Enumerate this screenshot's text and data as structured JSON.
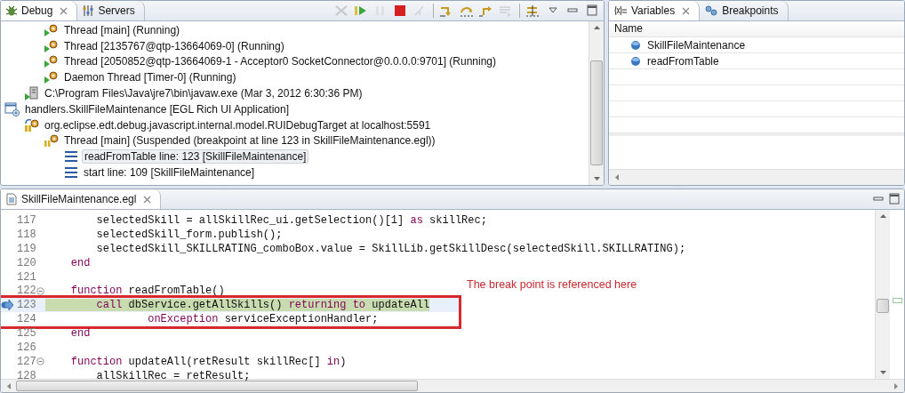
{
  "debug_view": {
    "tabs": [
      {
        "label": "Debug",
        "selected": true
      },
      {
        "label": "Servers",
        "selected": false
      }
    ],
    "toolbar": [
      {
        "kind": "remove",
        "disabled": true
      },
      {
        "kind": "resume",
        "disabled": false
      },
      {
        "kind": "suspend",
        "disabled": true
      },
      {
        "kind": "terminate",
        "disabled": false
      },
      {
        "kind": "disconnect",
        "disabled": true
      },
      {
        "kind": "sep"
      },
      {
        "kind": "step-into",
        "disabled": false
      },
      {
        "kind": "step-over",
        "disabled": false
      },
      {
        "kind": "step-return",
        "disabled": false
      },
      {
        "kind": "drop-frame",
        "disabled": true
      },
      {
        "kind": "sep"
      },
      {
        "kind": "step-filters",
        "disabled": false
      },
      {
        "kind": "menu",
        "disabled": false
      },
      {
        "kind": "minimize",
        "disabled": false
      },
      {
        "kind": "maximize",
        "disabled": false
      }
    ],
    "tree": [
      {
        "children": [
          {
            "children": [
              {
                "label": "Thread [main] (Running)",
                "kind": "thread-running",
                "selected": false
              },
              {
                "label": "Thread [2135767@qtp-13664069-0] (Running)",
                "kind": "thread-running",
                "selected": false
              },
              {
                "label": "Thread [2050852@qtp-13664069-1 - Acceptor0 SocketConnector@0.0.0.0:9701] (Running)",
                "kind": "thread-running",
                "selected": false
              },
              {
                "label": "Daemon Thread [Timer-0] (Running)",
                "kind": "thread-running",
                "selected": false
              }
            ]
          },
          {
            "label": "C:\\Program Files\\Java\\jre7\\bin\\javaw.exe (Mar 3, 2012 6:30:36 PM)",
            "kind": "process",
            "selected": false
          }
        ]
      },
      {
        "label": "handlers.SkillFileMaintenance [EGL Rich UI Application]",
        "kind": "application",
        "selected": false,
        "children": [
          {
            "label": "org.eclipse.edt.debug.javascript.internal.model.RUIDebugTarget at localhost:5591",
            "kind": "target",
            "selected": false,
            "children": [
              {
                "label": "Thread [main] (Suspended (breakpoint at line 123 in SkillFileMaintenance.egl))",
                "kind": "thread-suspended",
                "selected": false,
                "children": [
                  {
                    "label": "readFromTable line: 123 [SkillFileMaintenance]",
                    "kind": "frame",
                    "selected": true
                  },
                  {
                    "label": "start line: 109 [SkillFileMaintenance]",
                    "kind": "frame",
                    "selected": false
                  }
                ]
              }
            ]
          }
        ]
      }
    ]
  },
  "variables_view": {
    "tabs": [
      {
        "label": "Variables",
        "selected": true
      },
      {
        "label": "Breakpoints",
        "selected": false
      }
    ],
    "column": "Name",
    "rows": [
      "SkillFileMaintenance",
      "readFromTable"
    ]
  },
  "editor": {
    "tab": {
      "label": "SkillFileMaintenance.egl",
      "selected": true
    },
    "lines": [
      {
        "number": "117",
        "folded": false,
        "current": false,
        "breakpoint": false,
        "annotated": false,
        "segments": [
          {
            "kind": "plain",
            "text": "        selectedSkill = allSkillRec_ui.getSelection()[1] "
          },
          {
            "kind": "keyword",
            "text": "as"
          },
          {
            "kind": "plain",
            "text": " skillRec;"
          }
        ]
      },
      {
        "number": "118",
        "folded": false,
        "current": false,
        "breakpoint": false,
        "annotated": false,
        "segments": [
          {
            "kind": "plain",
            "text": "        selectedSkill_form.publish();"
          }
        ]
      },
      {
        "number": "119",
        "folded": false,
        "current": false,
        "breakpoint": false,
        "annotated": false,
        "segments": [
          {
            "kind": "plain",
            "text": "        selectedSkill_SKILLRATING_comboBox.value = SkillLib.getSkillDesc(selectedSkill.SKILLRATING);"
          }
        ]
      },
      {
        "number": "120",
        "folded": false,
        "current": false,
        "breakpoint": false,
        "annotated": false,
        "segments": [
          {
            "kind": "keyword",
            "text": "    end"
          }
        ]
      },
      {
        "number": "121",
        "folded": false,
        "current": false,
        "breakpoint": false,
        "annotated": false
      },
      {
        "number": "122",
        "folded": true,
        "current": false,
        "breakpoint": false,
        "annotated": false,
        "segments": [
          {
            "kind": "keyword",
            "text": "    function"
          },
          {
            "kind": "plain",
            "text": " readFromTable()"
          }
        ]
      },
      {
        "number": "123",
        "folded": false,
        "current": true,
        "breakpoint": true,
        "annotated": true,
        "segments": [
          {
            "kind": "keyword",
            "text": "        call"
          },
          {
            "kind": "plain",
            "text": " dbService.getAllSkills() "
          },
          {
            "kind": "keyword",
            "text": "returning to"
          },
          {
            "kind": "plain",
            "text": " updateAll"
          }
        ]
      },
      {
        "number": "124",
        "folded": false,
        "current": false,
        "breakpoint": false,
        "annotated": true,
        "segments": [
          {
            "kind": "keyword",
            "text": "                onException"
          },
          {
            "kind": "plain",
            "text": " serviceExceptionHandler;"
          }
        ]
      },
      {
        "number": "125",
        "folded": false,
        "current": false,
        "breakpoint": false,
        "annotated": false,
        "segments": [
          {
            "kind": "keyword",
            "text": "    end"
          }
        ]
      },
      {
        "number": "126",
        "folded": false,
        "current": false,
        "breakpoint": false,
        "annotated": false
      },
      {
        "number": "127",
        "folded": true,
        "current": false,
        "breakpoint": false,
        "annotated": false,
        "segments": [
          {
            "kind": "keyword",
            "text": "    function"
          },
          {
            "kind": "plain",
            "text": " updateAll(retResult skillRec[] "
          },
          {
            "kind": "keyword",
            "text": "in"
          },
          {
            "kind": "plain",
            "text": ")"
          }
        ]
      },
      {
        "number": "128",
        "folded": false,
        "current": false,
        "breakpoint": false,
        "annotated": false,
        "segments": [
          {
            "kind": "plain",
            "text": "        allSkillRec = retResult;"
          }
        ]
      }
    ],
    "annotation": "The break point is referenced here"
  }
}
